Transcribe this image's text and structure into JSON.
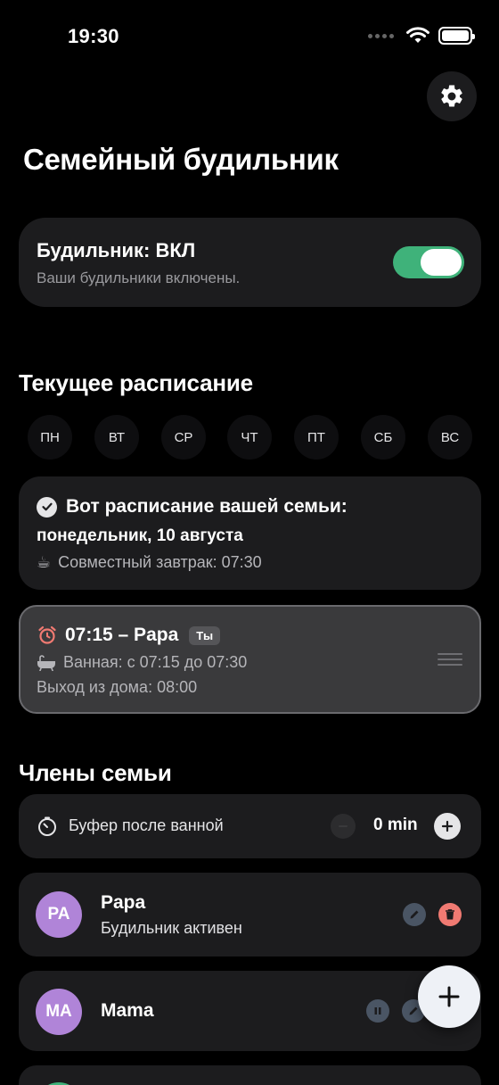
{
  "status_bar": {
    "time": "19:30"
  },
  "page": {
    "title": "Семейный будильник"
  },
  "alarm": {
    "title": "Будильник: ВКЛ",
    "subtitle": "Ваши будильники включены.",
    "enabled": true
  },
  "schedule": {
    "section_title": "Текущее расписание",
    "days": [
      "ПН",
      "ВТ",
      "СР",
      "ЧТ",
      "ПТ",
      "СБ",
      "ВС"
    ],
    "summary": {
      "heading": "Вот расписание вашей семьи:",
      "date": "понедельник, 10 августа",
      "breakfast_icon": "☕",
      "breakfast": "Совместный завтрак: 07:30"
    },
    "entry": {
      "alarm_icon": "alarm-clock-icon",
      "title": "07:15 – Papa",
      "badge": "Ты",
      "bath": "Ванная: с 07:15 до 07:30",
      "leave": "Выход из дома: 08:00"
    }
  },
  "family": {
    "section_title": "Члены семьи",
    "buffer": {
      "label": "Буфер после ванной",
      "value": "0 min"
    },
    "members": [
      {
        "initials": "PA",
        "name": "Papa",
        "status": "Будильник активен"
      },
      {
        "initials": "MA",
        "name": "Mama",
        "status": ""
      }
    ]
  },
  "colors": {
    "accent_green": "#3fb27a",
    "avatar_purple": "#b084d8",
    "delete_red": "#f07a72",
    "card": "#1c1c1e"
  }
}
